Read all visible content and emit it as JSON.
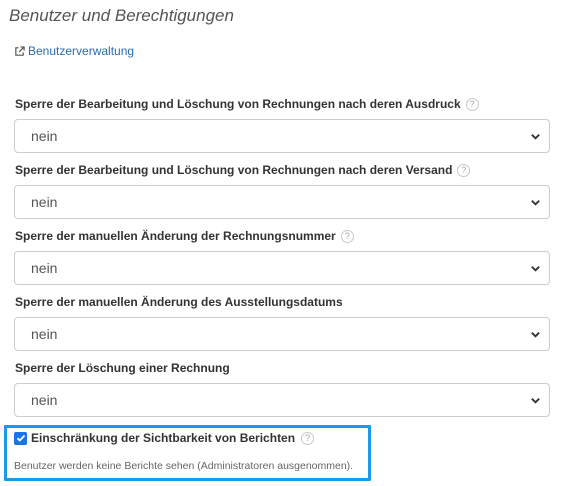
{
  "section": {
    "title": "Benutzer und Berechtigungen",
    "link_label": "Benutzerverwaltung"
  },
  "fields": [
    {
      "label": "Sperre der Bearbeitung und Löschung von Rechnungen nach deren Ausdruck",
      "value": "nein",
      "has_help": true
    },
    {
      "label": "Sperre der Bearbeitung und Löschung von Rechnungen nach deren Versand",
      "value": "nein",
      "has_help": true
    },
    {
      "label": "Sperre der manuellen Änderung der Rechnungsnummer",
      "value": "nein",
      "has_help": true
    },
    {
      "label": "Sperre der manuellen Änderung des Ausstellungsdatums",
      "value": "nein",
      "has_help": false
    },
    {
      "label": "Sperre der Löschung einer Rechnung",
      "value": "nein",
      "has_help": false
    }
  ],
  "report_visibility": {
    "label": "Einschränkung der Sichtbarkeit von Berichten",
    "checked": true,
    "hint": "Benutzer werden keine Berichte sehen (Administratoren ausgenommen)."
  },
  "help_glyph": "?",
  "colors": {
    "link": "#2a6db0",
    "highlight": "#1a9be6",
    "checkbox": "#1a73e8"
  }
}
